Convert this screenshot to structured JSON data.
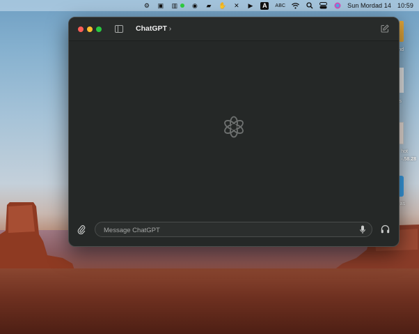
{
  "menubar": {
    "date": "Sun Mordad 14",
    "time": "10:59",
    "input_indicator": "A",
    "keyboard_layout": "ABC",
    "icons": [
      "chatgpt-status-icon",
      "screen-capture-icon",
      "battery-monitor-icon",
      "vpn-icon",
      "remote-desktop-icon",
      "hand-icon",
      "sound-muted-icon",
      "play-icon",
      "input-source-icon",
      "wifi-icon",
      "search-icon",
      "control-center-icon",
      "siri-icon"
    ]
  },
  "window": {
    "title": "ChatGPT",
    "title_chevron": "›",
    "composer": {
      "placeholder": "Message ChatGPT",
      "value": ""
    }
  },
  "desktop": {
    "item_labels": [
      "nd",
      "s",
      "hot",
      "-.58.28",
      "as"
    ]
  },
  "colors": {
    "window_bg": "#252827",
    "close": "#fe5f57",
    "minimize": "#febc2e",
    "zoom": "#28c840"
  }
}
